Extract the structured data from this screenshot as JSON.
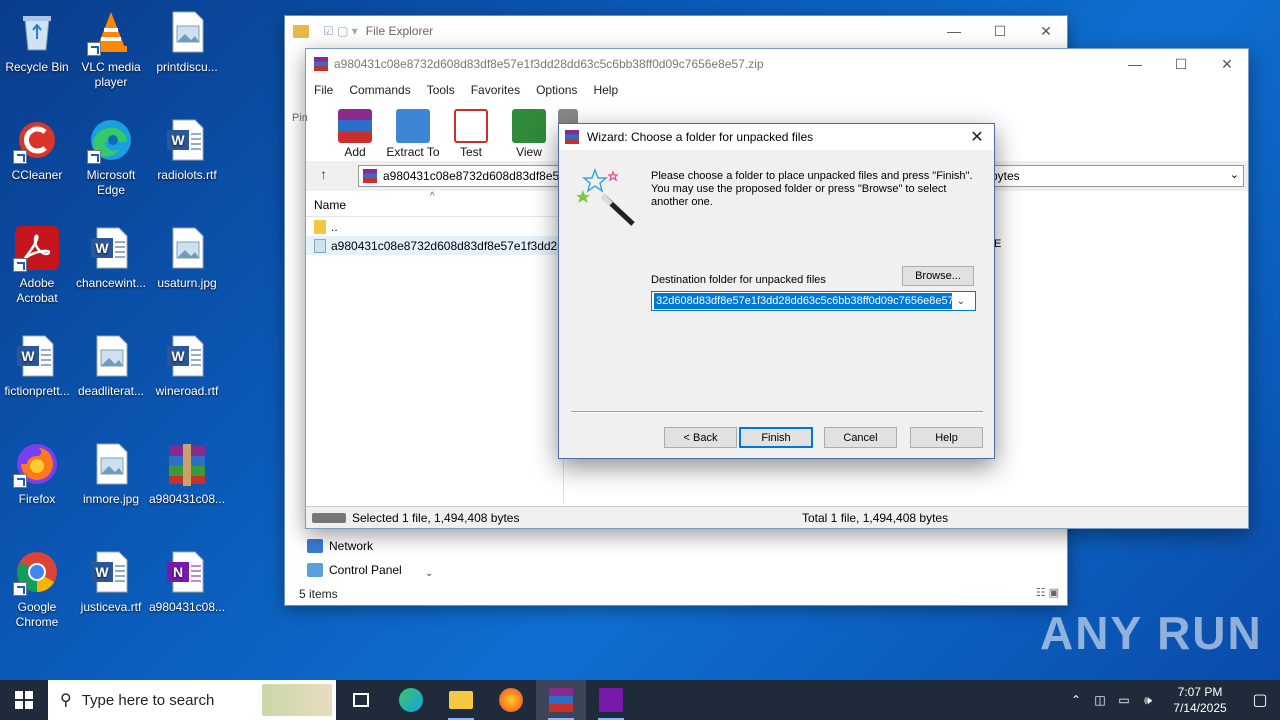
{
  "desktop": {
    "icons": [
      {
        "label": "Recycle Bin",
        "icon": "recycle-bin-icon"
      },
      {
        "label": "VLC media player",
        "icon": "vlc-icon"
      },
      {
        "label": "printdiscu...",
        "icon": "image-file-icon"
      },
      {
        "label": "CCleaner",
        "icon": "ccleaner-icon"
      },
      {
        "label": "Microsoft Edge",
        "icon": "edge-icon"
      },
      {
        "label": "radiolots.rtf",
        "icon": "word-doc-icon"
      },
      {
        "label": "Adobe Acrobat",
        "icon": "acrobat-icon"
      },
      {
        "label": "chancewint...",
        "icon": "word-doc-icon"
      },
      {
        "label": "usaturn.jpg",
        "icon": "image-file-icon"
      },
      {
        "label": "fictionprett...",
        "icon": "word-doc-icon"
      },
      {
        "label": "deadliterat...",
        "icon": "image-file-icon"
      },
      {
        "label": "wineroad.rtf",
        "icon": "word-doc-icon"
      },
      {
        "label": "Firefox",
        "icon": "firefox-icon"
      },
      {
        "label": "inmore.jpg",
        "icon": "image-file-icon"
      },
      {
        "label": "a980431c08...",
        "icon": "winrar-archive-icon"
      },
      {
        "label": "Google Chrome",
        "icon": "chrome-icon"
      },
      {
        "label": "justiceva.rtf",
        "icon": "word-doc-icon"
      },
      {
        "label": "a980431c08...",
        "icon": "onenote-file-icon"
      }
    ]
  },
  "explorer": {
    "title": "File Explorer",
    "nav": [
      {
        "label": "Network",
        "icon": "network-icon"
      },
      {
        "label": "Control Panel",
        "icon": "control-panel-icon"
      }
    ],
    "status": "5 items"
  },
  "winrar": {
    "title": "a980431c08e8732d608d83df8e57e1f3dd28dd63c5c6bb38ff0d09c7656e8e57.zip",
    "menu": [
      "File",
      "Commands",
      "Tools",
      "Favorites",
      "Options",
      "Help"
    ],
    "toolbar": [
      {
        "label": "Add",
        "icon": "add-archive-icon"
      },
      {
        "label": "Extract To",
        "icon": "extract-to-icon"
      },
      {
        "label": "Test",
        "icon": "test-icon"
      },
      {
        "label": "View",
        "icon": "view-icon"
      },
      {
        "label": "D",
        "icon": "delete-icon"
      }
    ],
    "path": "a980431c08e8732d608d83df8e57e",
    "path_tail": "bytes",
    "column_name": "Name",
    "files": [
      {
        "name": ".."
      },
      {
        "name": "a980431c08e8732d608d83df8e57e1f3dd28..."
      }
    ],
    "col_fragment": "E",
    "status_left": "Selected 1 file, 1,494,408 bytes",
    "status_right": "Total 1 file, 1,494,408 bytes",
    "side_label": "Pin"
  },
  "wizard": {
    "title": "Wizard:   Choose a folder for unpacked files",
    "description": "Please choose a folder to place unpacked files and press \"Finish\". You may use the proposed folder or press \"Browse\" to select another one.",
    "dest_label": "Destination folder for unpacked files",
    "dest_value": "32d608d83df8e57e1f3dd28dd63c5c6bb38ff0d09c7656e8e57",
    "browse": "Browse...",
    "back": "< Back",
    "finish": "Finish",
    "cancel": "Cancel",
    "help": "Help"
  },
  "taskbar": {
    "search_placeholder": "Type here to search",
    "time": "7:07 PM",
    "date": "7/14/2025"
  },
  "watermark": "ANY RUN",
  "colors": {
    "accent": "#0078d7",
    "taskbar": "#1f2a3b"
  }
}
